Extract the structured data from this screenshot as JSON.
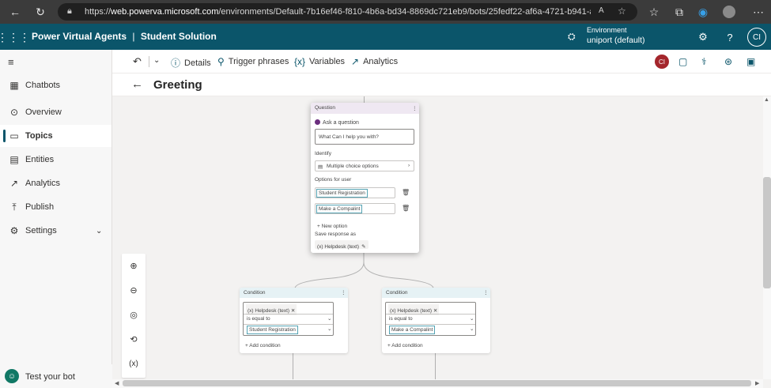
{
  "browser": {
    "url_prefix": "https://",
    "url_domain": "web.powerva.microsoft.com",
    "url_path": "/environments/Default-7b16ef46-f810-4b6a-bd34-8869dc721eb9/bots/25fedf22-af6a-4721-b941-adb82974..."
  },
  "header": {
    "app_name": "Power Virtual Agents",
    "separator": "|",
    "solution_name": "Student Solution",
    "environment_label": "Environment",
    "environment_value": "uniport (default)",
    "avatar_initials": "CI"
  },
  "sidebar": {
    "items": [
      {
        "label": "Chatbots",
        "icon": "chatbots-icon"
      },
      {
        "label": "Overview",
        "icon": "overview-icon"
      },
      {
        "label": "Topics",
        "icon": "topics-icon"
      },
      {
        "label": "Entities",
        "icon": "entities-icon"
      },
      {
        "label": "Analytics",
        "icon": "analytics-icon"
      },
      {
        "label": "Publish",
        "icon": "publish-icon"
      },
      {
        "label": "Settings",
        "icon": "settings-icon"
      }
    ],
    "test_bot": "Test your bot"
  },
  "toolbar": {
    "details": "Details",
    "trigger_phrases": "Trigger phrases",
    "variables": "Variables",
    "analytics": "Analytics",
    "avatar_initials": "CI"
  },
  "page": {
    "title": "Greeting"
  },
  "question_node": {
    "header": "Question",
    "ask_label": "Ask a question",
    "question_text": "What Can I help you with?",
    "identify_label": "Identify",
    "identify_value": "Multiple choice options",
    "options_label": "Options for user",
    "options": [
      "Student Registration",
      "Make a Compalint"
    ],
    "new_option": "New option",
    "save_label": "Save response as",
    "variable_name": "Helpdesk (text)"
  },
  "conditions": [
    {
      "header": "Condition",
      "variable": "Helpdesk (text)",
      "operator": "is equal to",
      "value": "Student Registration",
      "add": "Add condition"
    },
    {
      "header": "Condition",
      "variable": "Helpdesk (text)",
      "operator": "is equal to",
      "value": "Make a Compalint",
      "add": "Add condition"
    }
  ],
  "colors": {
    "header_bg": "#0b556a",
    "accent": "#0b556a",
    "avatar_red": "#a4262c"
  }
}
